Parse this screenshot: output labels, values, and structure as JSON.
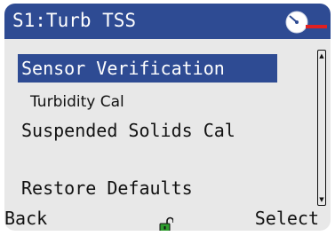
{
  "header": {
    "title": "S1:Turb TSS",
    "status_icon": "gauge-icon"
  },
  "menu": {
    "items": [
      {
        "label": "Sensor Verification",
        "selected": true
      },
      {
        "label": "Turbidity Cal",
        "selected": false
      },
      {
        "label": "Suspended Solids Cal",
        "selected": false
      },
      {
        "label": "",
        "selected": false
      },
      {
        "label": "Restore Defaults",
        "selected": false
      }
    ]
  },
  "softkeys": {
    "left": "Back",
    "right": "Select",
    "center_icon": "unlocked-padlock-icon"
  },
  "colors": {
    "title_bar": "#2e4b93",
    "selection": "#2e4b93",
    "screen_bg": "#e8e8e8",
    "lock_green": "#2e9e2e",
    "indicator_red": "#e02020"
  }
}
